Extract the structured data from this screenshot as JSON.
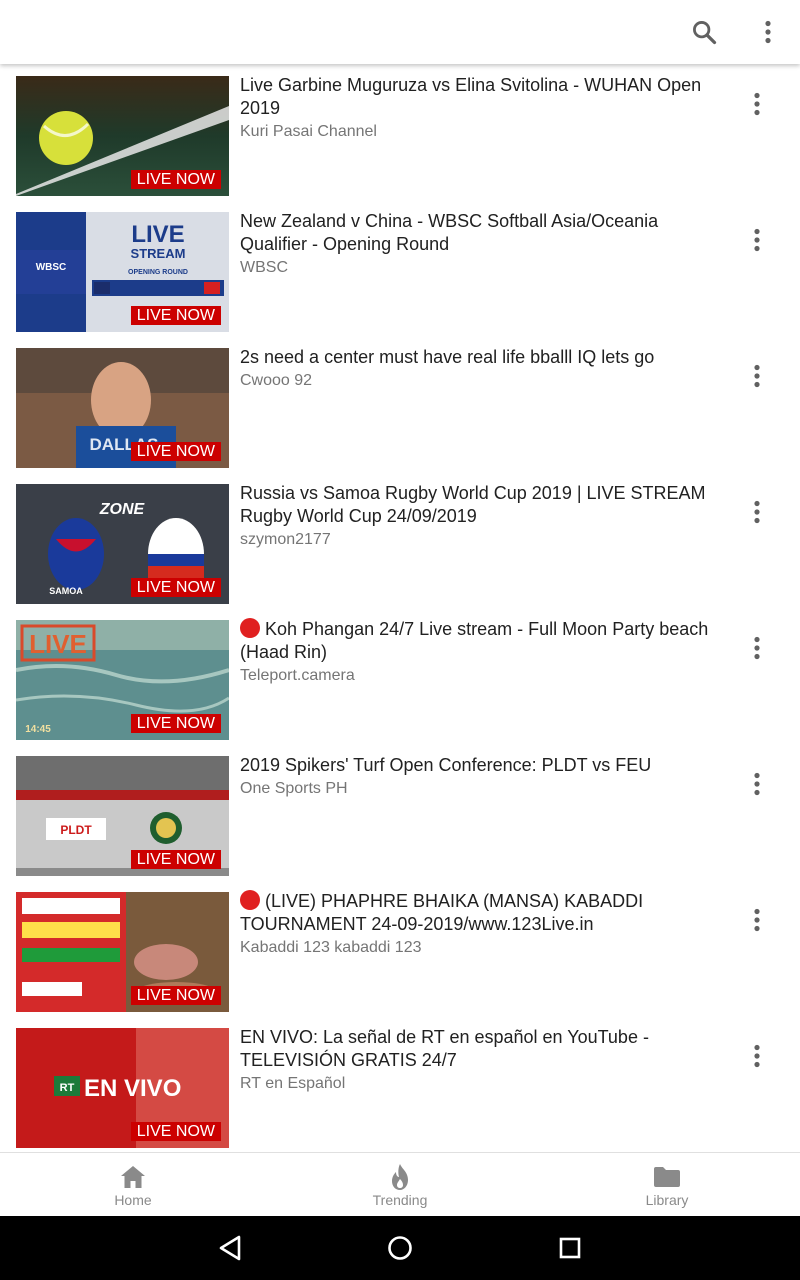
{
  "toolbar": {
    "search_icon": "search-icon",
    "more_icon": "more-vert-icon"
  },
  "videos": [
    {
      "title": "Live Garbine Muguruza vs Elina Svitolina - WUHAN Open 2019",
      "channel": "Kuri Pasai Channel",
      "badge": "LIVE NOW",
      "red_dot": false
    },
    {
      "title": "New Zealand v China - WBSC Softball Asia/Oceania Qualifier - Opening Round",
      "channel": "WBSC",
      "badge": "LIVE NOW",
      "red_dot": false
    },
    {
      "title": "2s need a center must have real life bballl IQ lets go",
      "channel": "Cwooo 92",
      "badge": "LIVE NOW",
      "red_dot": false
    },
    {
      "title": "Russia vs Samoa Rugby World Cup 2019 | LIVE STREAM Rugby World Cup 24/09/2019",
      "channel": "szymon2177",
      "badge": "LIVE NOW",
      "red_dot": false
    },
    {
      "title": "Koh Phangan 24/7 Live stream - Full Moon Party beach (Haad Rin)",
      "channel": "Teleport.camera",
      "badge": "LIVE NOW",
      "red_dot": true
    },
    {
      "title": "2019 Spikers' Turf Open Conference: PLDT vs FEU",
      "channel": "One Sports PH",
      "badge": "LIVE NOW",
      "red_dot": false
    },
    {
      "title": "(LIVE) PHAPHRE BHAIKA (MANSA) KABADDI TOURNAMENT 24-09-2019/www.123Live.in",
      "channel": "Kabaddi 123 kabaddi 123",
      "badge": "LIVE NOW",
      "red_dot": true
    },
    {
      "title": "EN VIVO: La señal de RT en español en YouTube - TELEVISIÓN GRATIS 24/7",
      "channel": "RT en Español",
      "badge": "LIVE NOW",
      "red_dot": false
    }
  ],
  "thumb_text": {
    "wbsc_live": "LIVE",
    "wbsc_stream": "STREAM",
    "wbsc_round": "OPENING ROUND",
    "wbsc_logo": "WBSC",
    "dallas": "DALLAS",
    "rugby_zone": "ZONE",
    "rugby_samoa": "SAMOA",
    "koh_live": "LIVE",
    "koh_time": "14:45",
    "pldt": "PLDT",
    "envivo": "EN VIVO",
    "rt": "RT"
  },
  "bottom_nav": [
    {
      "label": "Home",
      "icon": "home-icon"
    },
    {
      "label": "Trending",
      "icon": "flame-icon"
    },
    {
      "label": "Library",
      "icon": "folder-icon"
    }
  ],
  "system_nav": [
    "back-icon",
    "home-circle-icon",
    "recents-icon"
  ],
  "colors": {
    "live_badge": "#cc0000",
    "title_text": "#212121",
    "secondary_text": "#757575",
    "nav_label": "#8a8a8a"
  }
}
